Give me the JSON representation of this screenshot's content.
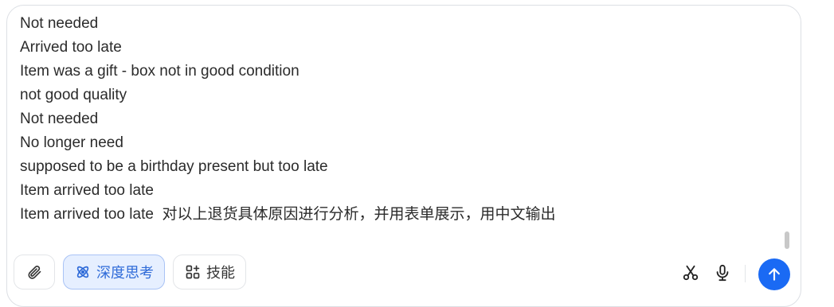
{
  "input": {
    "lines": [
      "Not needed",
      "Arrived too late",
      "Item was a gift - box not in good condition",
      "not good quality",
      "Not needed",
      "No longer need",
      "supposed to be a birthday present but too late",
      "Item arrived too late",
      "Item arrived too late  对以上退货具体原因进行分析，并用表单展示，用中文输出"
    ]
  },
  "toolbar": {
    "deep_think_label": "深度思考",
    "skills_label": "技能"
  },
  "icons": {
    "attach": "paperclip-icon",
    "deep_think": "atom-icon",
    "skills": "apps-grid-icon",
    "cut": "scissors-icon",
    "mic": "microphone-icon",
    "send": "arrow-up-icon"
  },
  "colors": {
    "accent": "#1a6af4",
    "deep_think_bg": "#e6efff",
    "deep_think_text": "#2f6bd8"
  }
}
